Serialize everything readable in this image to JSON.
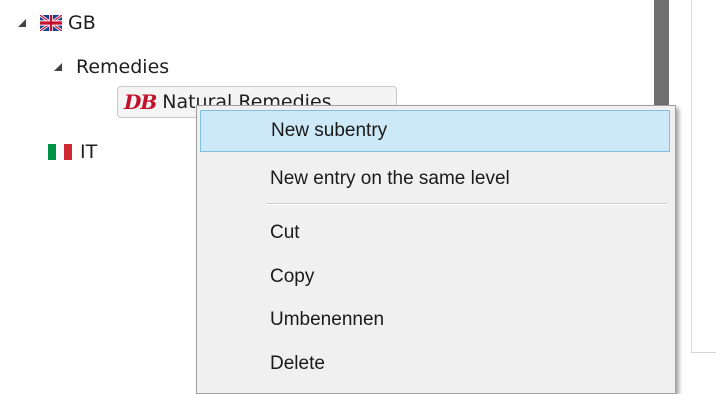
{
  "tree": {
    "gb": {
      "label": "GB",
      "icon": "uk-flag-icon"
    },
    "remedies": {
      "label": "Remedies"
    },
    "natural_remedies": {
      "label": "Natural Remedies",
      "icon": "db-logo-icon",
      "icon_text": "DB"
    },
    "it": {
      "label": "IT",
      "icon": "italy-flag-icon"
    }
  },
  "context_menu": {
    "items": [
      {
        "label": "New subentry",
        "highlighted": true
      },
      {
        "label": "New entry on the same level"
      },
      {
        "label": "Cut"
      },
      {
        "label": "Copy"
      },
      {
        "label": "Umbenennen"
      },
      {
        "label": "Delete"
      }
    ]
  },
  "colors": {
    "highlight_bg": "#cde8f6",
    "highlight_border": "#7fbfe3",
    "menu_bg": "#f0f0f0",
    "splitter": "#6f6f6f",
    "db_logo": "#c0102a"
  }
}
